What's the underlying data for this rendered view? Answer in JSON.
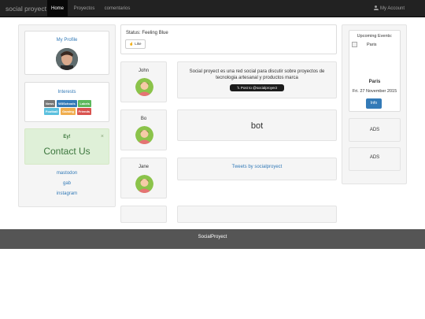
{
  "navbar": {
    "brand": "social proyect",
    "items": [
      {
        "label": "Home"
      },
      {
        "label": "Proyectos"
      },
      {
        "label": "comentarios"
      }
    ],
    "account": "My Account"
  },
  "left": {
    "profile_title": "My Profile",
    "interests_title": "Interests",
    "tags": [
      {
        "label": "News",
        "color": "#777777"
      },
      {
        "label": "W3Schools",
        "color": "#337ab7"
      },
      {
        "label": "Labels",
        "color": "#5cb85c"
      },
      {
        "label": "Football",
        "color": "#5bc0de"
      },
      {
        "label": "Gaming",
        "color": "#f0ad4e"
      },
      {
        "label": "Friends",
        "color": "#d9534f"
      }
    ],
    "contact": {
      "title": "Ey!",
      "close": "×",
      "text": "Contact Us"
    },
    "links": [
      "mastodon",
      "gab",
      "instagram"
    ]
  },
  "status": {
    "text": "Status: Feeling Blue",
    "like": "Like"
  },
  "feed": [
    {
      "name": "John",
      "text": "Social proyect es una red social para discutir sobre proyectos de tecnologia artesanal y productos marca",
      "button": "Post to @socialproyect"
    },
    {
      "name": "Bo",
      "text": "bot"
    },
    {
      "name": "Jane",
      "text": "Tweets by socialproyect"
    }
  ],
  "right": {
    "events_title": "Upcoming Events:",
    "image_alt": "Paris",
    "city": "Paris",
    "date": "Fri. 27 November 2015",
    "info_button": "Info",
    "ads": [
      "ADS",
      "ADS"
    ]
  },
  "footer": "SocialProyect",
  "colors": {
    "navbar": "#222222",
    "accent": "#337ab7",
    "contact_bg": "#dff0d8",
    "footer": "#555555"
  }
}
